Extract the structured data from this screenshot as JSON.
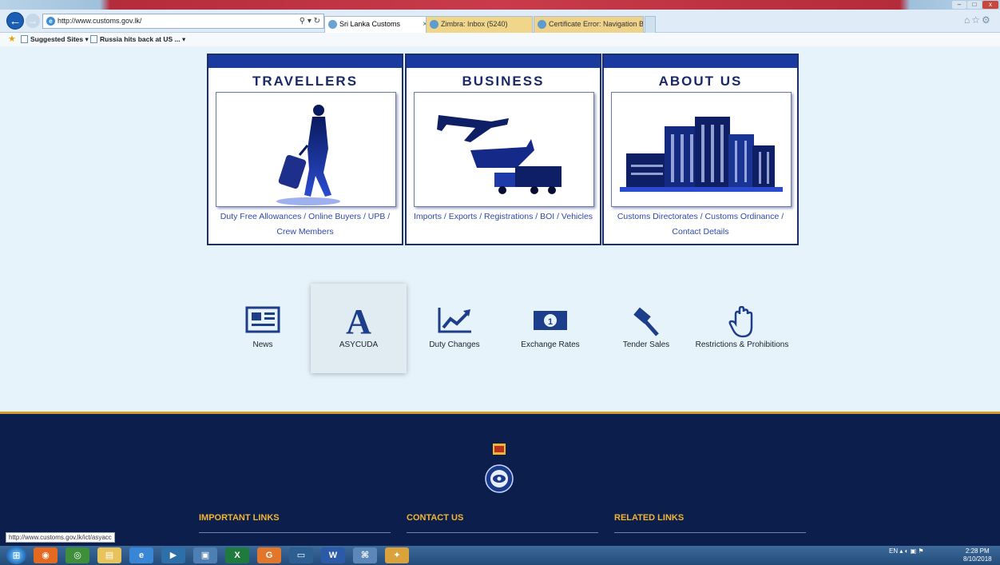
{
  "browser": {
    "url": "http://www.customs.gov.lk/",
    "address_tools": "⚲ ▾ ↻",
    "tabs": [
      {
        "label": "Sri Lanka Customs",
        "active": true
      },
      {
        "label": "Zimbra: Inbox (5240)"
      },
      {
        "label": "Certificate Error: Navigation Bl..."
      }
    ],
    "favorites": [
      {
        "label": "Suggested Sites ▾"
      },
      {
        "label": "Russia hits back at US ... ▾"
      }
    ],
    "window_controls": {
      "min": "–",
      "max": "□",
      "close": "x"
    },
    "top_right_icons": "⌂☆⚙",
    "status_url": "http://www.customs.gov.lk/ict/asyacc"
  },
  "cards": [
    {
      "title": "TRAVELLERS",
      "icon": "traveller-icon",
      "links": "Duty Free Allowances / Online Buyers / UPB / Crew Members"
    },
    {
      "title": "BUSINESS",
      "icon": "transport-icon",
      "links": "Imports / Exports / Registrations / BOI / Vehicles"
    },
    {
      "title": "ABOUT US",
      "icon": "building-icon",
      "links": "Customs Directorates / Customs Ordinance / Contact Details"
    }
  ],
  "quick_links": [
    {
      "label": "News",
      "icon": "newspaper-icon",
      "glyph": "📰"
    },
    {
      "label": "ASYCUDA",
      "icon": "asycuda-icon",
      "glyph": "A"
    },
    {
      "label": "Duty Changes",
      "icon": "chart-icon",
      "glyph": "📈"
    },
    {
      "label": "Exchange Rates",
      "icon": "banknote-icon",
      "glyph": "💵"
    },
    {
      "label": "Tender Sales",
      "icon": "gavel-icon",
      "glyph": "🔨"
    },
    {
      "label": "Restrictions & Prohibitions",
      "icon": "hand-icon",
      "glyph": "✋"
    }
  ],
  "footer": {
    "columns": [
      {
        "heading": "IMPORTANT LINKS"
      },
      {
        "heading": "CONTACT US"
      },
      {
        "heading": "RELATED LINKS"
      }
    ]
  },
  "taskbar": {
    "lang": "EN",
    "tray_icons": "▴ ◐ ▣ ⚑",
    "time": "2:28 PM",
    "date": "8/10/2018"
  },
  "colors": {
    "navy": "#1b2e6e",
    "footer_bg": "#0c1f4c",
    "footer_heading": "#f2b431",
    "link_blue": "#2f4aa8"
  }
}
